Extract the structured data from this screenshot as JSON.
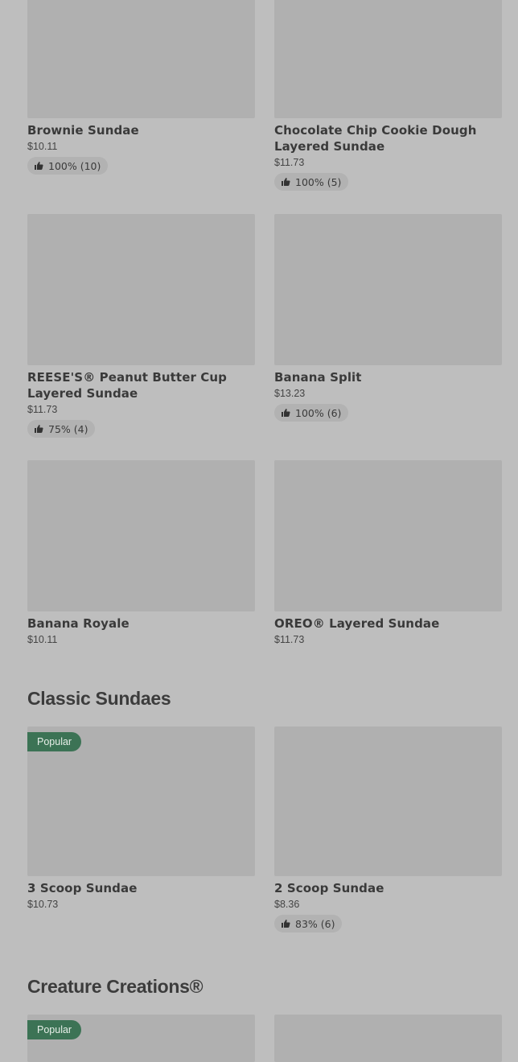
{
  "sections": [
    {
      "title": "",
      "items": [
        {
          "name": "Brownie Sundae",
          "price": "$10.11",
          "rating": "100% (10)"
        },
        {
          "name": "Chocolate Chip Cookie Dough Layered Sundae",
          "price": "$11.73",
          "rating": "100% (5)"
        },
        {
          "name": "REESE'S® Peanut Butter Cup Layered Sundae",
          "price": "$11.73",
          "rating": "75% (4)"
        },
        {
          "name": "Banana Split",
          "price": "$13.23",
          "rating": "100% (6)"
        },
        {
          "name": "Banana Royale",
          "price": "$10.11"
        },
        {
          "name": "OREO® Layered Sundae",
          "price": "$11.73"
        }
      ]
    },
    {
      "title": "Classic Sundaes",
      "items": [
        {
          "name": "3 Scoop Sundae",
          "price": "$10.73",
          "badge": "Popular"
        },
        {
          "name": "2 Scoop Sundae",
          "price": "$8.36",
          "rating": "83% (6)"
        }
      ]
    },
    {
      "title": "Creature Creations®",
      "items": [
        {
          "badge": "Popular"
        }
      ]
    }
  ],
  "icons": {
    "rating": "thumbs-up-icon"
  },
  "colors": {
    "badge": "#3c7355",
    "background": "#bebebe",
    "thumb": "#b0b0b0"
  }
}
